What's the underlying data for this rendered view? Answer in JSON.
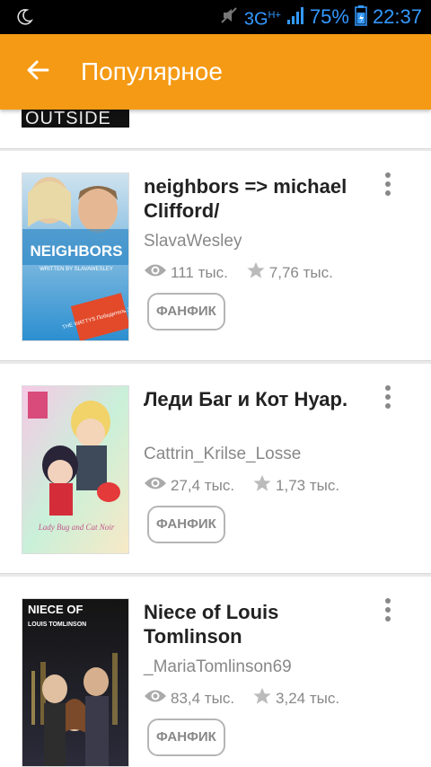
{
  "status_bar": {
    "network": "3G",
    "network_sup": "H+",
    "battery": "75%",
    "time": "22:37"
  },
  "app_bar": {
    "title": "Популярное"
  },
  "top_partial": {
    "cover_text": "OUTSIDE"
  },
  "stories": [
    {
      "title": "neighbors => michael Clifford/",
      "author": "SlavaWesley",
      "reads": "111 тыс.",
      "votes": "7,76 тыс.",
      "tag": "ФАНФИК",
      "cover_text": "NEIGHBORS",
      "cover_sub": "WRITTEN BY SLAVAWESLEY",
      "cover_badge": "THE WATTYS Победитель 2015"
    },
    {
      "title": "Леди Баг и Кот Нуар.",
      "author": "Cattrin_Krilse_Losse",
      "reads": "27,4 тыс.",
      "votes": "1,73 тыс.",
      "tag": "ФАНФИК",
      "cover_text": "Lady Bug and Cat Noir"
    },
    {
      "title": "Niece of Louis Tomlinson",
      "author": "_MariaTomlinson69",
      "reads": "83,4 тыс.",
      "votes": "3,24 тыс.",
      "tag": "ФАНФИК",
      "cover_text": "NIECE OF",
      "cover_sub": "LOUIS TOMLINSON"
    }
  ],
  "colors": {
    "accent": "#f59a14",
    "status_bar": "#000000",
    "text_secondary": "#888888"
  },
  "icons": {
    "back": "arrow-left-icon",
    "reads": "eye-icon",
    "votes": "star-icon",
    "more": "more-vert-icon"
  }
}
